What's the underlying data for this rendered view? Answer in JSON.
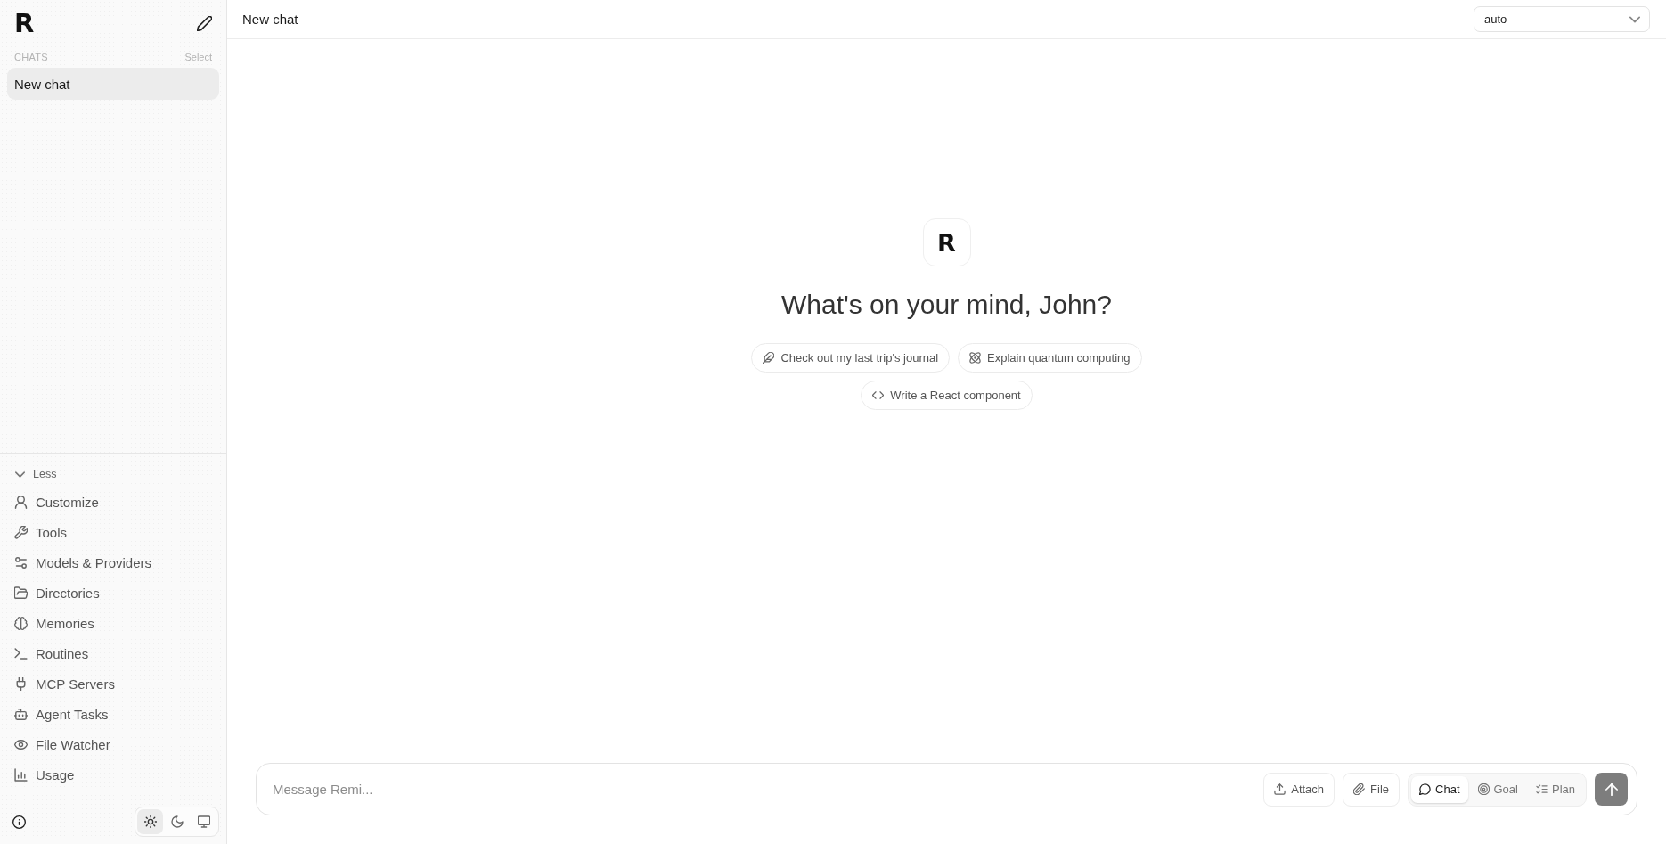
{
  "sidebar": {
    "logo": "R",
    "chats_label": "CHATS",
    "select_action": "Select",
    "chats": [
      {
        "title": "New chat",
        "selected": true
      }
    ],
    "nav_toggle": {
      "label": "Less",
      "expanded": true
    },
    "nav_items": [
      {
        "label": "Customize"
      },
      {
        "label": "Tools"
      },
      {
        "label": "Models & Providers"
      },
      {
        "label": "Directories"
      },
      {
        "label": "Memories"
      },
      {
        "label": "Routines"
      },
      {
        "label": "MCP Servers"
      },
      {
        "label": "Agent Tasks"
      },
      {
        "label": "File Watcher"
      },
      {
        "label": "Usage"
      }
    ],
    "theme_options": [
      {
        "selected": true
      },
      {
        "selected": false
      },
      {
        "selected": false
      }
    ]
  },
  "header": {
    "title": "New chat",
    "model_select": {
      "value": "auto"
    }
  },
  "welcome": {
    "logo": "R",
    "heading": "What's on your mind, John?",
    "suggestions": [
      {
        "label": "Check out my last trip's journal"
      },
      {
        "label": "Explain quantum computing"
      },
      {
        "label": "Write a React component"
      }
    ]
  },
  "composer": {
    "placeholder": "Message Remi...",
    "buttons": [
      {
        "label": "Attach"
      },
      {
        "label": "File"
      }
    ],
    "modes": [
      {
        "label": "Chat",
        "selected": true
      },
      {
        "label": "Goal",
        "selected": false
      },
      {
        "label": "Plan",
        "selected": false
      }
    ]
  }
}
